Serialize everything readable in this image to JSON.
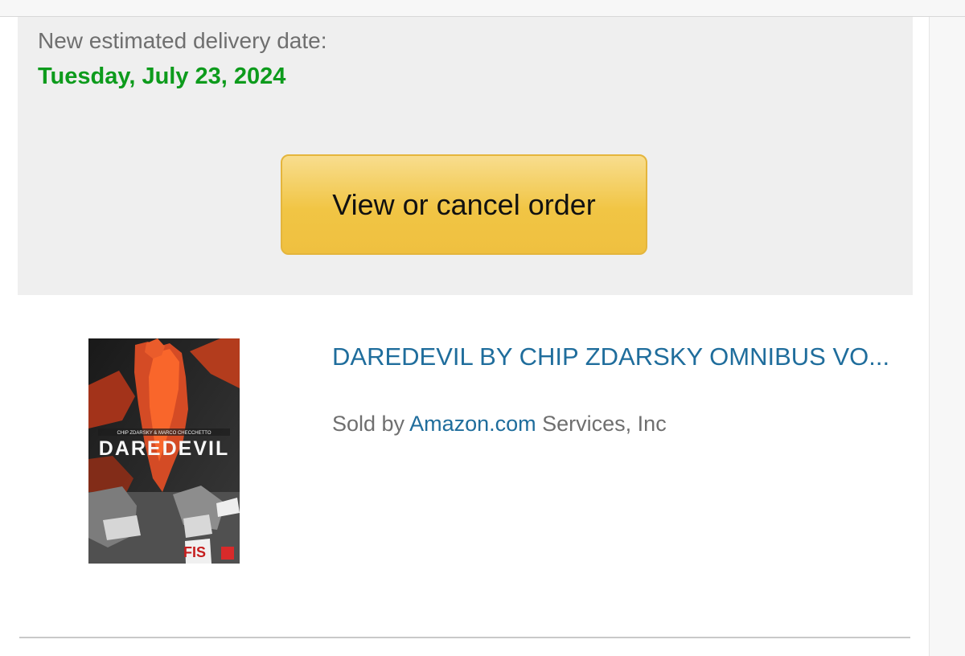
{
  "delivery": {
    "label": "New estimated delivery date:",
    "date": "Tuesday, July 23, 2024"
  },
  "actions": {
    "view_cancel_label": "View or cancel order"
  },
  "product": {
    "title": "DAREDEVIL BY CHIP ZDARSKY OMNIBUS VO...",
    "seller_prefix": "Sold by ",
    "seller_link": "Amazon.com",
    "seller_suffix": " Services, Inc",
    "cover_title": "DAREDEVIL",
    "cover_credits": "CHIP ZDARSKY & MARCO CHECCHETTO",
    "cover_corner": "FIS"
  },
  "colors": {
    "accent_green": "#0d9b1c",
    "link_blue": "#1f6d9c",
    "button_yellow": "#f1c544",
    "panel_gray": "#efefef"
  },
  "icons": {
    "cover_image": "book-cover-image"
  }
}
